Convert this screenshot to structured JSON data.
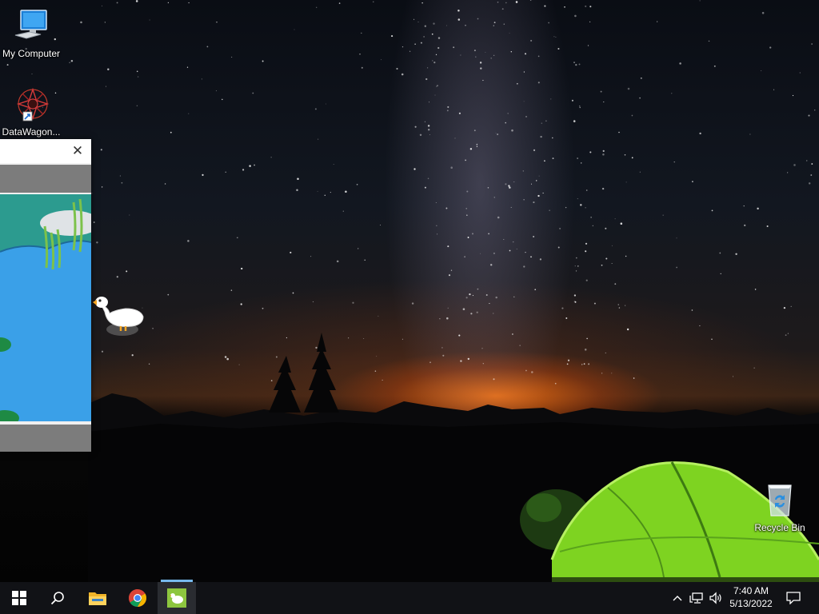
{
  "desktop": {
    "icons": [
      {
        "label": "My Computer",
        "icon": "computer-icon"
      },
      {
        "label": "DataWagon...",
        "icon": "datawagon-shortcut-icon"
      },
      {
        "label": "Recycle Bin",
        "icon": "recycle-bin-icon"
      }
    ]
  },
  "goose_window": {
    "close_glyph": "✕"
  },
  "taskbar": {
    "start": {
      "icon": "windows-start-icon"
    },
    "search": {
      "icon": "search-icon"
    },
    "pinned": [
      {
        "name": "File Explorer",
        "icon": "file-explorer-icon"
      },
      {
        "name": "Google Chrome",
        "icon": "chrome-icon"
      },
      {
        "name": "Desktop Goose",
        "icon": "goose-app-icon",
        "active": true
      }
    ],
    "tray": {
      "overflow_icon": "chevron-up-icon",
      "network_icon": "network-icon",
      "volume_icon": "volume-icon",
      "time": "7:40 AM",
      "date": "5/13/2022",
      "notification_icon": "action-center-icon"
    }
  },
  "colors": {
    "taskbar": "#111216",
    "active_indicator": "#76b9ed",
    "tent": "#7ed321",
    "water": "#3aa0e8"
  }
}
